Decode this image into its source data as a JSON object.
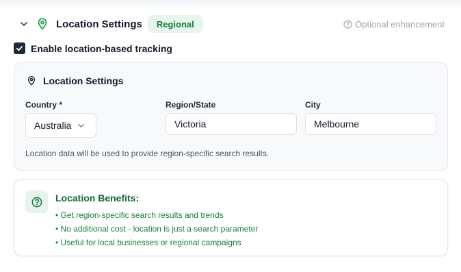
{
  "header": {
    "title": "Location Settings",
    "badge": "Regional",
    "optional_note": "Optional enhancement"
  },
  "tracking": {
    "label": "Enable location-based tracking",
    "checked": true
  },
  "location_card": {
    "title": "Location Settings",
    "country": {
      "label": "Country *",
      "value": "Australia"
    },
    "region": {
      "label": "Region/State",
      "value": "Victoria"
    },
    "city": {
      "label": "City",
      "value": "Melbourne"
    },
    "hint": "Location data will be used to provide region-specific search results."
  },
  "benefits": {
    "title": "Location Benefits:",
    "items": [
      "• Get region-specific search results and trends",
      "• No additional cost - location is just a search parameter",
      "• Useful for local businesses or regional campaigns"
    ]
  },
  "colors": {
    "accent_green": "#15803d",
    "badge_bg": "#e8f5ec",
    "checkbox": "#1f2937"
  }
}
